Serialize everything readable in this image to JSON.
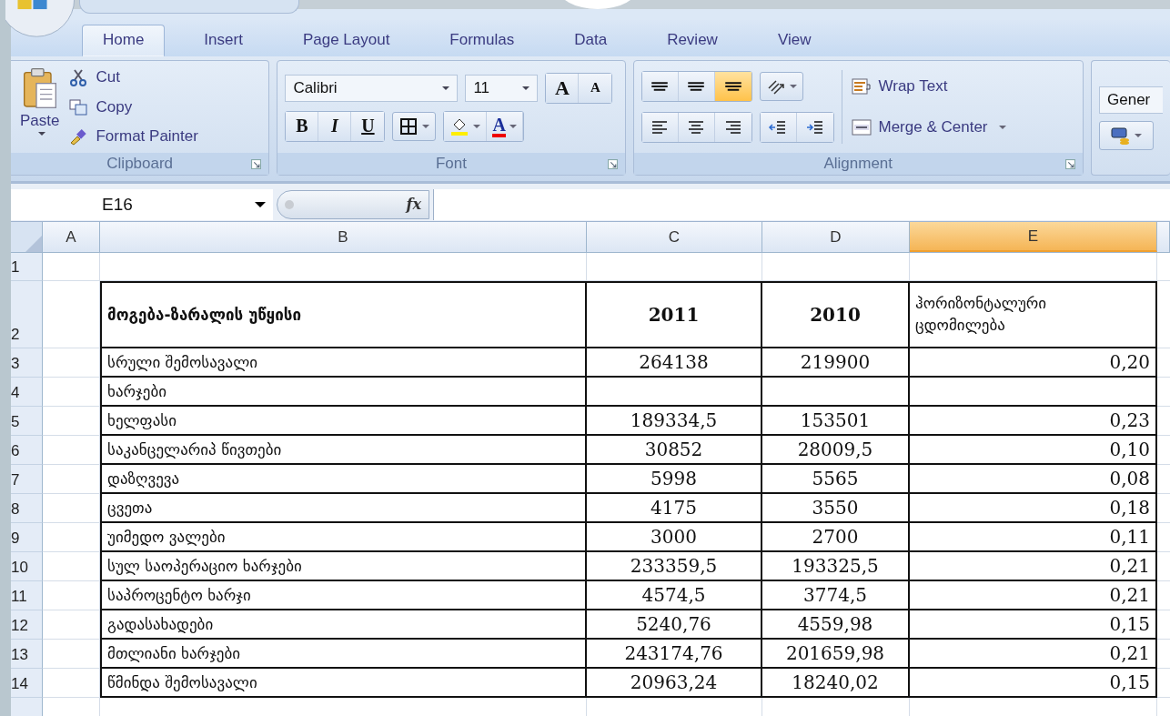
{
  "tabs": [
    {
      "label": "Home",
      "selected": true
    },
    {
      "label": "Insert",
      "selected": false
    },
    {
      "label": "Page Layout",
      "selected": false
    },
    {
      "label": "Formulas",
      "selected": false
    },
    {
      "label": "Data",
      "selected": false
    },
    {
      "label": "Review",
      "selected": false
    },
    {
      "label": "View",
      "selected": false
    }
  ],
  "clipboard": {
    "paste": "Paste",
    "cut": "Cut",
    "copy": "Copy",
    "format_painter": "Format Painter",
    "label": "Clipboard"
  },
  "font": {
    "name": "Calibri",
    "size": "11",
    "grow": "A",
    "shrink": "A",
    "bold": "B",
    "italic": "I",
    "underline": "U",
    "font_color": "A",
    "label": "Font"
  },
  "alignment": {
    "vertical": [
      {
        "selected": false
      },
      {
        "selected": false
      },
      {
        "selected": true
      }
    ],
    "wrap_text": "Wrap Text",
    "merge_center": "Merge & Center",
    "label": "Alignment"
  },
  "number": {
    "format": "Gener"
  },
  "name_box": "E16",
  "fx": "fx",
  "columns": [
    {
      "label": "A",
      "selected": false
    },
    {
      "label": "B",
      "selected": false
    },
    {
      "label": "C",
      "selected": false
    },
    {
      "label": "D",
      "selected": false
    },
    {
      "label": "E",
      "selected": true
    }
  ],
  "rows": [
    {
      "number": "1",
      "kind": "spacer"
    },
    {
      "number": "2",
      "kind": "header",
      "cells": [
        "მოგება-ზარალის უწყისი",
        "2011",
        "2010",
        "ჰორიზონტალური ცდომილება"
      ]
    },
    {
      "number": "3",
      "kind": "data",
      "cells": [
        "სრული შემოსავალი",
        "264138",
        "219900",
        "0,20"
      ]
    },
    {
      "number": "4",
      "kind": "data",
      "cells": [
        "ხარჯები"
      ]
    },
    {
      "number": "5",
      "kind": "data",
      "cells": [
        "ხელფასი",
        "189334,5",
        "153501",
        "0,23"
      ]
    },
    {
      "number": "6",
      "kind": "data",
      "cells": [
        "საკანცელარიპ წივთები",
        "30852",
        "28009,5",
        "0,10"
      ]
    },
    {
      "number": "7",
      "kind": "data",
      "cells": [
        "დაზღვევა",
        "5998",
        "5565",
        "0,08"
      ]
    },
    {
      "number": "8",
      "kind": "data",
      "cells": [
        "ცვეთა",
        "4175",
        "3550",
        "0,18"
      ]
    },
    {
      "number": "9",
      "kind": "data",
      "cells": [
        "უიმედო ვალები",
        "3000",
        "2700",
        "0,11"
      ]
    },
    {
      "number": "10",
      "kind": "data",
      "cells": [
        "სულ საოპერაციო ხარჯები",
        "233359,5",
        "193325,5",
        "0,21"
      ]
    },
    {
      "number": "11",
      "kind": "data",
      "cells": [
        "საპროცენტო ხარჯი",
        "4574,5",
        "3774,5",
        "0,21"
      ]
    },
    {
      "number": "12",
      "kind": "data",
      "cells": [
        "გადასახადები",
        "5240,76",
        "4559,98",
        "0,15"
      ]
    },
    {
      "number": "13",
      "kind": "data",
      "cells": [
        "მთლიანი ხარჯები",
        "243174,76",
        "201659,98",
        "0,21"
      ]
    },
    {
      "number": "14",
      "kind": "data",
      "cells": [
        "წმინდა შემოსავალი",
        "20963,24",
        "18240,02",
        "0,15"
      ]
    }
  ]
}
